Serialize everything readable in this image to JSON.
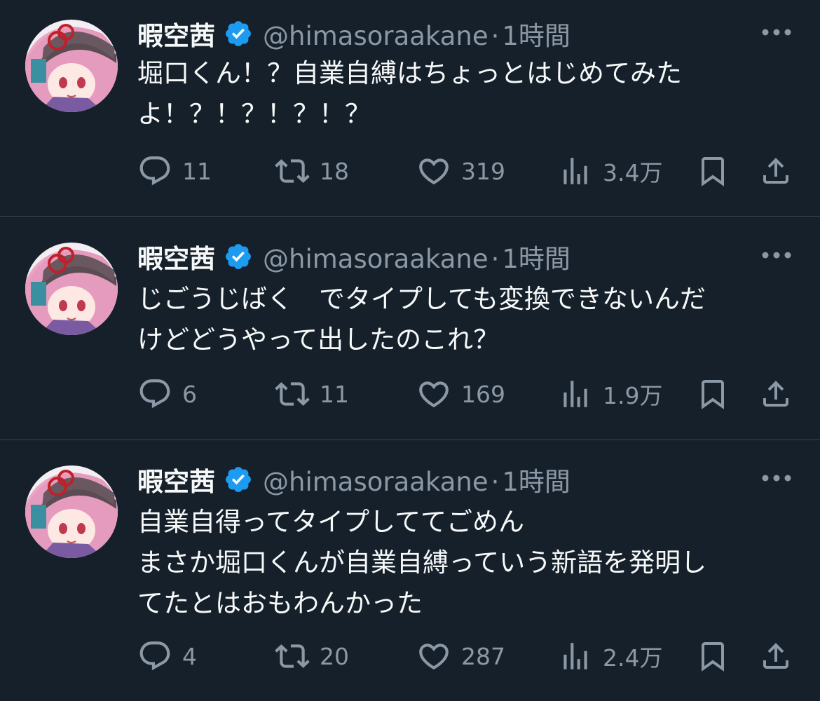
{
  "tweets": [
    {
      "name": "暇空茜",
      "handle": "@himasoraakane",
      "time": "1時間",
      "text": "堀口くん！？自業自縛はちょっとはじめてみた\nよ！？！？！？！？",
      "replies": "11",
      "retweets": "18",
      "likes": "319",
      "views": "3.4万"
    },
    {
      "name": "暇空茜",
      "handle": "@himasoraakane",
      "time": "1時間",
      "text": "じごうじばく　でタイプしても変換できないんだ\nけどどうやって出したのこれ？",
      "replies": "6",
      "retweets": "11",
      "likes": "169",
      "views": "1.9万"
    },
    {
      "name": "暇空茜",
      "handle": "@himasoraakane",
      "time": "1時間",
      "text": "自業自得ってタイプしててごめん\nまさか堀口くんが自業自縛っていう新語を発明し\nてたとはおもわんかった",
      "replies": "4",
      "retweets": "20",
      "likes": "287",
      "views": "2.4万"
    }
  ],
  "colors": {
    "background": "#15202b",
    "text": "#f7f9f9",
    "secondary": "#8b98a5",
    "verified": "#1d9bf0",
    "divider": "#38444d"
  },
  "icons": [
    "reply-icon",
    "retweet-icon",
    "like-icon",
    "views-icon",
    "bookmark-icon",
    "share-icon",
    "more-icon",
    "verified-icon"
  ]
}
